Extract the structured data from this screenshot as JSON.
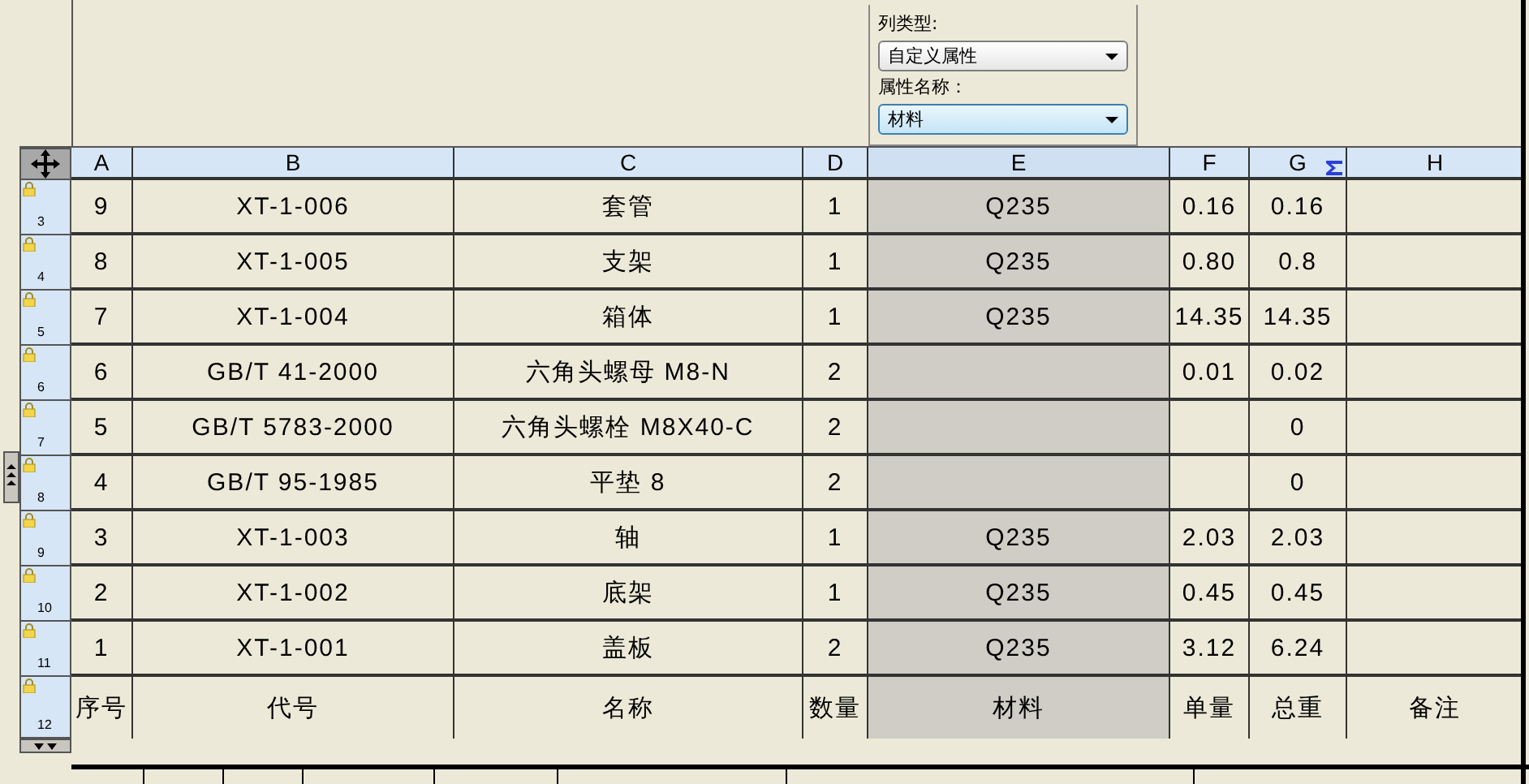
{
  "panel": {
    "column_type_label": "列类型:",
    "column_type": "自定义属性",
    "attribute_name_label": "属性名称：",
    "attribute_name": "材料"
  },
  "columns": [
    {
      "label": "A",
      "selected": false,
      "sum": false
    },
    {
      "label": "B",
      "selected": false,
      "sum": false
    },
    {
      "label": "C",
      "selected": false,
      "sum": false
    },
    {
      "label": "D",
      "selected": false,
      "sum": false
    },
    {
      "label": "E",
      "selected": true,
      "sum": false
    },
    {
      "label": "F",
      "selected": false,
      "sum": false
    },
    {
      "label": "G",
      "selected": false,
      "sum": true
    },
    {
      "label": "H",
      "selected": false,
      "sum": false
    }
  ],
  "rows": [
    {
      "number": "3",
      "locked": true,
      "cells": [
        "9",
        "XT-1-006",
        "套管",
        "1",
        "Q235",
        "0.16",
        "0.16",
        null
      ]
    },
    {
      "number": "4",
      "locked": true,
      "cells": [
        "8",
        "XT-1-005",
        "支架",
        "1",
        "Q235",
        "0.80",
        "0.8",
        null
      ]
    },
    {
      "number": "5",
      "locked": true,
      "cells": [
        "7",
        "XT-1-004",
        "箱体",
        "1",
        "Q235",
        "14.35",
        "14.35",
        null
      ]
    },
    {
      "number": "6",
      "locked": true,
      "cells": [
        "6",
        "GB/T 41-2000",
        "六角头螺母 M8-N",
        "2",
        null,
        "0.01",
        "0.02",
        null
      ]
    },
    {
      "number": "7",
      "locked": true,
      "cells": [
        "5",
        "GB/T 5783-2000",
        "六角头螺栓 M8X40-C",
        "2",
        null,
        null,
        "0",
        null
      ]
    },
    {
      "number": "8",
      "locked": true,
      "cells": [
        "4",
        "GB/T 95-1985",
        "平垫 8",
        "2",
        null,
        null,
        "0",
        null
      ]
    },
    {
      "number": "9",
      "locked": true,
      "cells": [
        "3",
        "XT-1-003",
        "轴",
        "1",
        "Q235",
        "2.03",
        "2.03",
        null
      ]
    },
    {
      "number": "10",
      "locked": true,
      "cells": [
        "2",
        "XT-1-002",
        "底架",
        "1",
        "Q235",
        "0.45",
        "0.45",
        null
      ]
    },
    {
      "number": "11",
      "locked": true,
      "cells": [
        "1",
        "XT-1-001",
        "盖板",
        "2",
        "Q235",
        "3.12",
        "6.24",
        null
      ]
    },
    {
      "number": "12",
      "locked": true,
      "cells": [
        "序号",
        "代号",
        "名称",
        "数量",
        "材料",
        "单量",
        "总重",
        "备注"
      ]
    }
  ]
}
